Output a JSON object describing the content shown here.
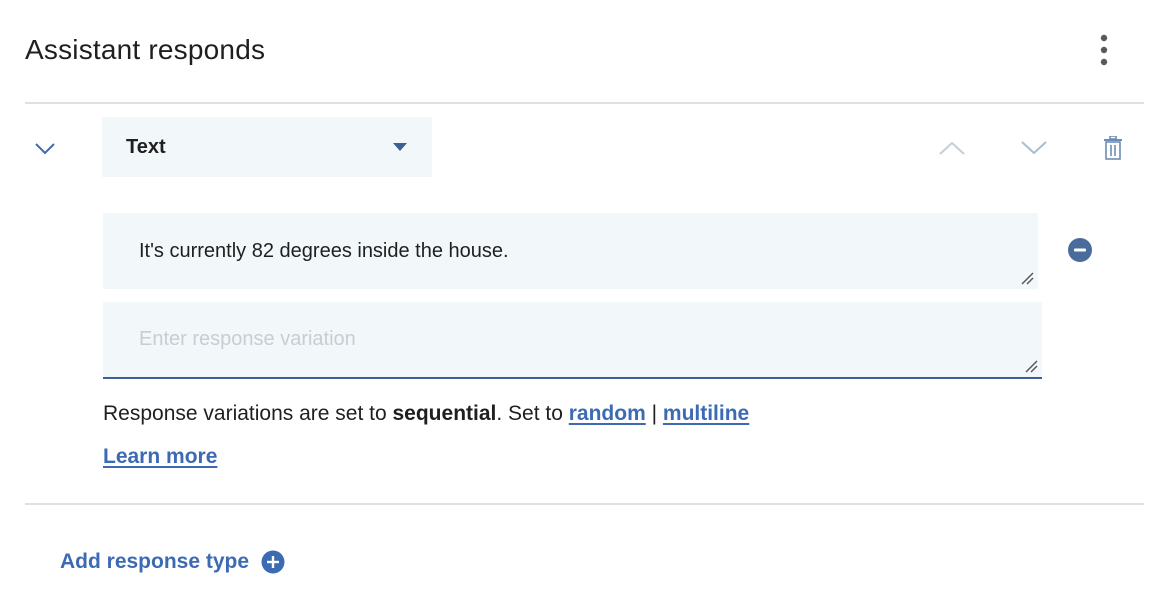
{
  "header": {
    "title": "Assistant responds",
    "overflow_icon": "overflow-menu-vertical-icon"
  },
  "response": {
    "collapse_icon": "chevron-down-icon",
    "type_select": {
      "selected": "Text",
      "icon": "caret-down-icon"
    },
    "controls": {
      "move_up_icon": "chevron-up-icon",
      "move_down_icon": "chevron-down-icon",
      "delete_icon": "trash-icon"
    },
    "variations": [
      {
        "value": "It's currently 82 degrees inside the house."
      }
    ],
    "new_variation": {
      "placeholder": "Enter response variation"
    },
    "settings": {
      "prefix": "Response variations are set to ",
      "mode": "sequential",
      "middle": ". Set to ",
      "option_random": "random",
      "separator": " | ",
      "option_multiline": "multiline",
      "learn_more": "Learn more"
    }
  },
  "footer": {
    "add_response_label": "Add response type",
    "add_icon": "add-filled-icon"
  },
  "colors": {
    "accent": "#3d6bb3",
    "field_bg": "#f2f7fa",
    "divider": "#e0e0e0",
    "remove_icon": "#4a6c9b"
  }
}
